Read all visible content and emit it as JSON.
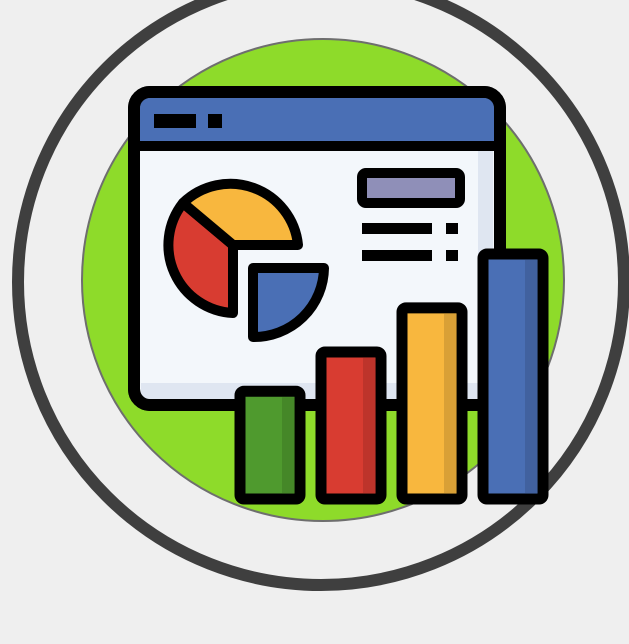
{
  "icon": {
    "name": "analytics-dashboard-icon",
    "description_tags": [
      "browser-window",
      "pie-chart",
      "bar-chart",
      "text-lines"
    ]
  },
  "colors": {
    "background": "#efefef",
    "ring": "#3f3f3f",
    "disc": "#8edb2a",
    "outline": "#000000",
    "titlebar": "#4a6fb5",
    "window": "#f3f7fb",
    "window_shade": "#dfe6f1",
    "pie_yellow": "#f8b73e",
    "pie_red": "#d83c31",
    "pie_blue": "#4a6fb5",
    "label_box": "#8f8fb8",
    "bar_green": "#4f9a2e",
    "bar_red": "#d83c31",
    "bar_yellow": "#f8b73e",
    "bar_blue": "#4a6fb5"
  },
  "bars": [
    {
      "name": "bar-green",
      "level": 0.44,
      "color_key": "bar_green"
    },
    {
      "name": "bar-red",
      "level": 0.6,
      "color_key": "bar_red"
    },
    {
      "name": "bar-yellow",
      "level": 0.78,
      "color_key": "bar_yellow"
    },
    {
      "name": "bar-blue",
      "level": 1.0,
      "color_key": "bar_blue"
    }
  ]
}
